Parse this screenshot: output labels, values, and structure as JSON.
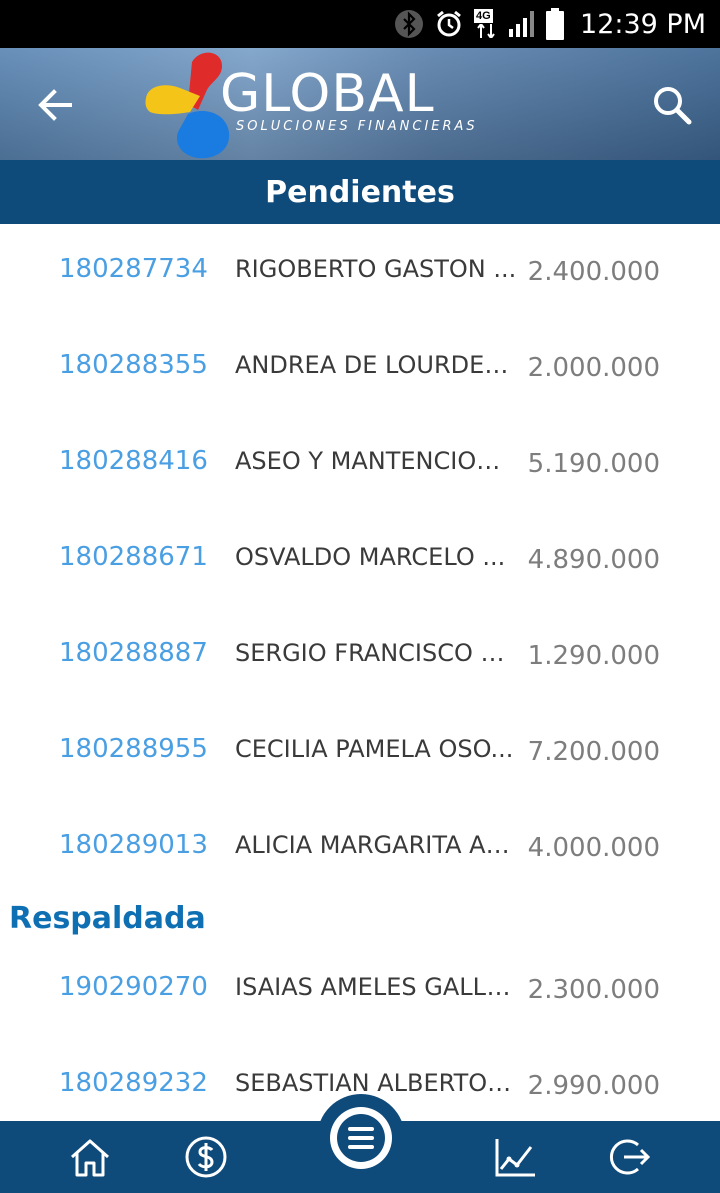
{
  "status_bar": {
    "time": "12:39 PM",
    "network": "4G"
  },
  "header": {
    "brand": "GLOBAL",
    "tagline": "SOLUCIONES FINANCIERAS",
    "title": "Pendientes",
    "back_icon": "arrow-left-icon",
    "search_icon": "search-icon"
  },
  "colors": {
    "primary": "#0e4a7a",
    "code": "#4a9fe3",
    "section": "#0f6fb3",
    "amount": "#7d7d7d"
  },
  "items": [
    {
      "code": "180287734",
      "name": "RIGOBERTO GASTON ...",
      "amount": "2.400.000"
    },
    {
      "code": "180288355",
      "name": "ANDREA DE LOURDES ...",
      "amount": "2.000.000"
    },
    {
      "code": "180288416",
      "name": "ASEO Y MANTENCION...",
      "amount": "5.190.000"
    },
    {
      "code": "180288671",
      "name": "OSVALDO MARCELO ...",
      "amount": "4.890.000"
    },
    {
      "code": "180288887",
      "name": "SERGIO FRANCISCO Z...",
      "amount": "1.290.000"
    },
    {
      "code": "180288955",
      "name": "CECILIA PAMELA OSO...",
      "amount": "7.200.000"
    },
    {
      "code": "180289013",
      "name": "ALICIA MARGARITA AR...",
      "amount": "4.000.000"
    }
  ],
  "section": {
    "title": "Respaldada",
    "items": [
      {
        "code": "190290270",
        "name": "ISAIAS AMELES GALLA...",
        "amount": "2.300.000"
      },
      {
        "code": "180289232",
        "name": "SEBASTIAN ALBERTO S...",
        "amount": "2.990.000"
      }
    ]
  },
  "bottom_nav": {
    "items": [
      "home-icon",
      "dollar-icon",
      "menu-icon",
      "chart-icon",
      "logout-icon"
    ]
  }
}
